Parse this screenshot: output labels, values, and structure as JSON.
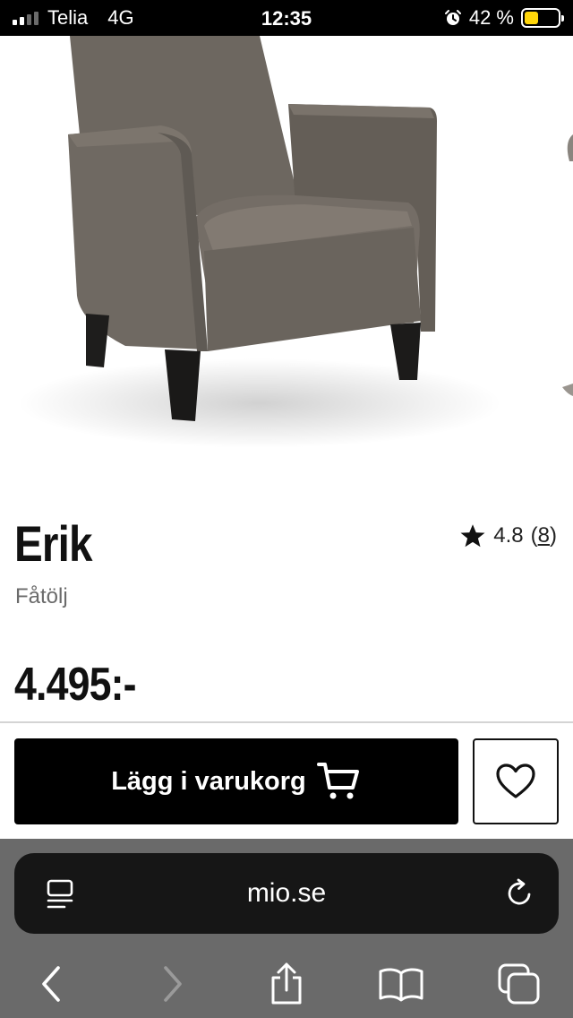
{
  "status_bar": {
    "carrier": "Telia",
    "network": "4G",
    "time": "12:35",
    "battery": "42 %",
    "battery_level": 0.42,
    "battery_color": "#ffd60a",
    "alarm_icon": "alarm-clock-icon"
  },
  "product": {
    "name": "Erik",
    "type": "Fåtölj",
    "rating": "4.8",
    "review_count": "8",
    "price": "4.495:-",
    "add_to_cart_label": "Lägg i varukorg",
    "image_icon": "armchair-image"
  },
  "browser": {
    "url": "mio.se",
    "icons": [
      "reader-icon",
      "reload-icon",
      "back-icon",
      "forward-icon",
      "share-icon",
      "bookmarks-icon",
      "tabs-icon"
    ]
  }
}
